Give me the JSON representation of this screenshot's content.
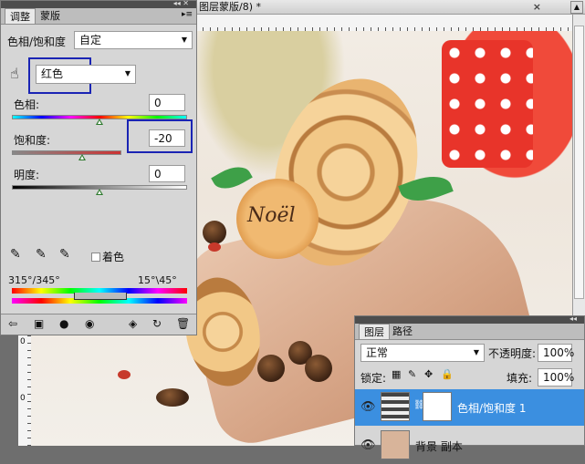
{
  "document": {
    "tab_title": "图层蒙版/8) *",
    "close_symbol": "×",
    "ruler_left_marks": [
      "0",
      "0"
    ]
  },
  "photo": {
    "cookie_text": "Noël"
  },
  "adjustments": {
    "tabs": [
      "调整",
      "蒙版"
    ],
    "active_tab": "调整",
    "menu_icon": "▸≡",
    "preset_label": "色相/饱和度",
    "preset_value": "自定",
    "channel_value": "红色",
    "hue": {
      "label": "色相:",
      "value": "0",
      "level": 0.5
    },
    "saturation": {
      "label": "饱和度:",
      "value": "-20",
      "level": 0.4
    },
    "lightness": {
      "label": "明度:",
      "value": "0",
      "level": 0.5
    },
    "colorize_label": "着色",
    "colorize_checked": false,
    "range_left": "315°/345°",
    "range_right": "15°\\45°",
    "highlight_color": "#1a24b4"
  },
  "layers": {
    "tabs": [
      "图层",
      "路径"
    ],
    "blend_mode": "正常",
    "opacity_label": "不透明度:",
    "opacity_value": "100%",
    "lock_label": "锁定:",
    "fill_label": "填充:",
    "fill_value": "100%",
    "items": [
      {
        "name": "色相/饱和度 1",
        "selected": true
      },
      {
        "name": "背景 副本",
        "selected": false
      }
    ],
    "selected_color": "#3b8fe0"
  }
}
